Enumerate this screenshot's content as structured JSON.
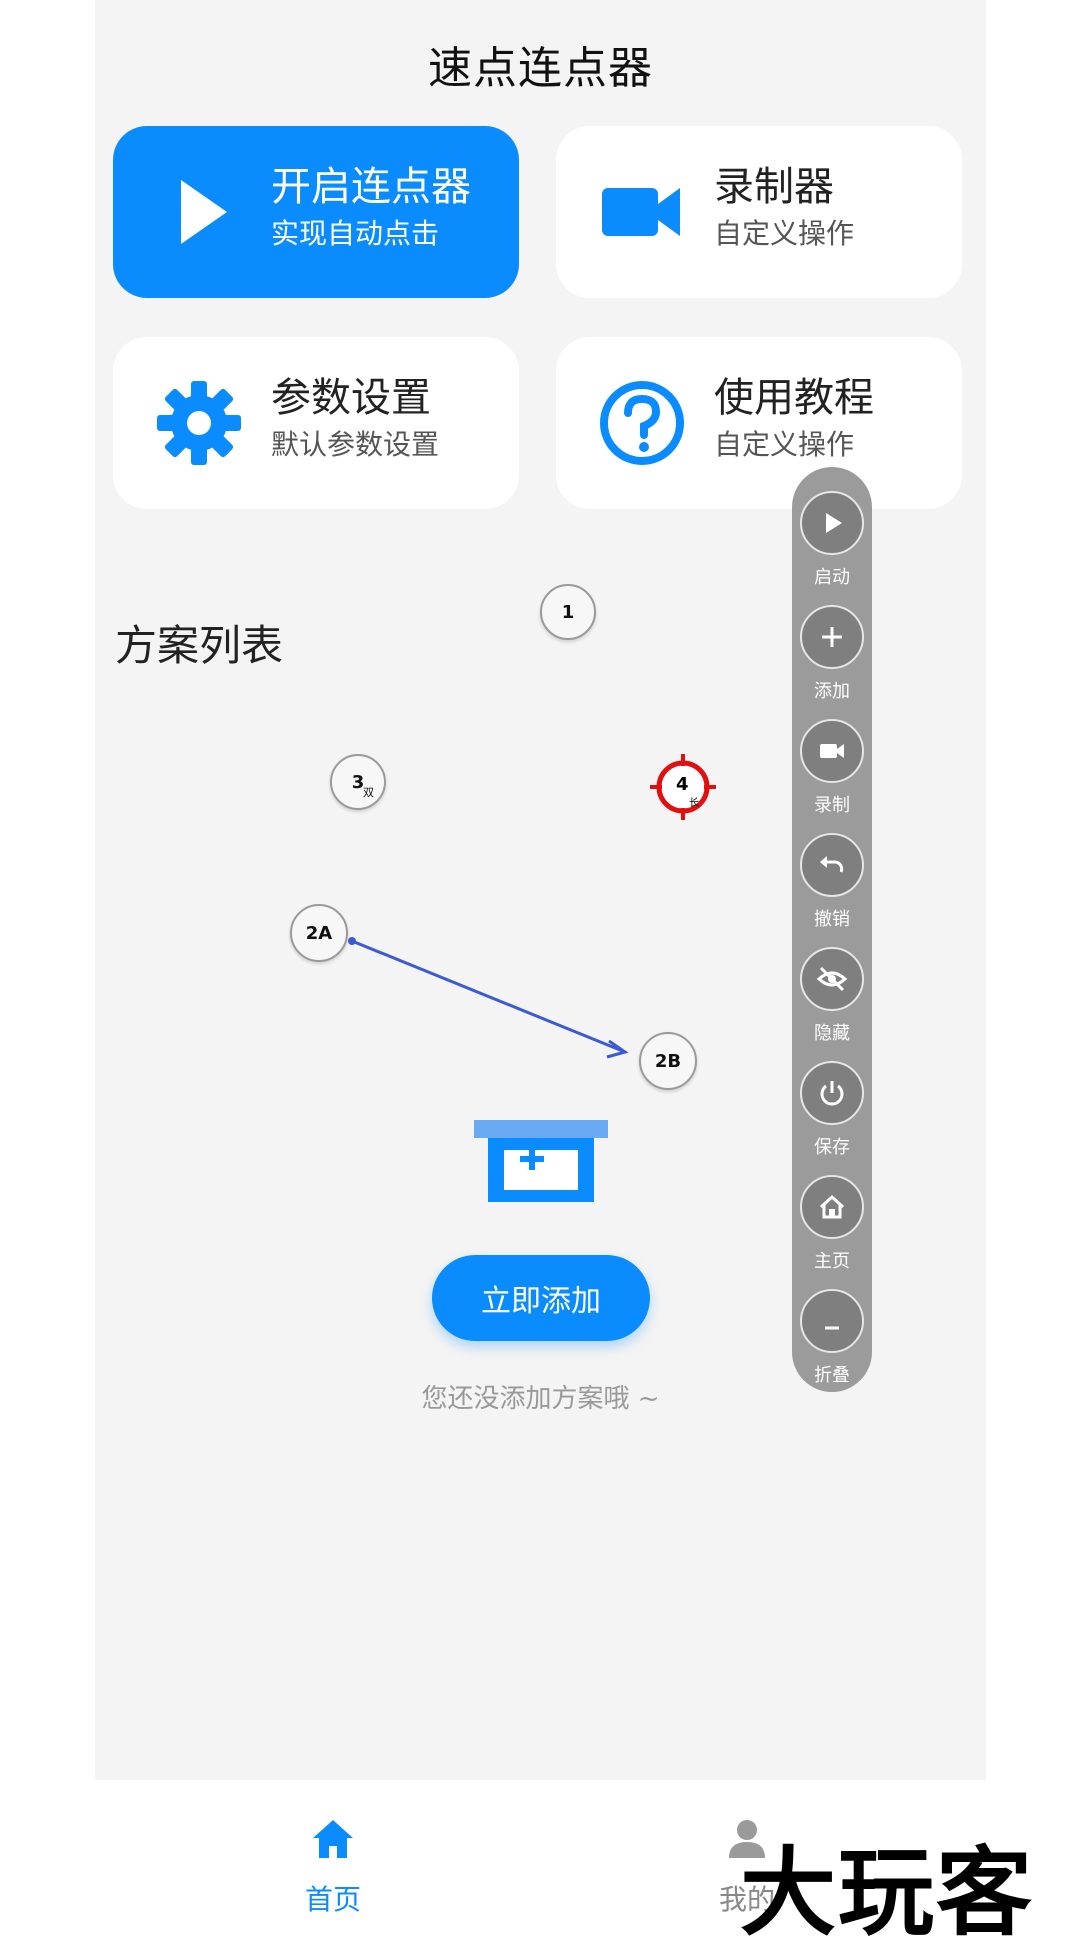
{
  "header": {
    "title": "速点连点器"
  },
  "cards": [
    {
      "title": "开启连点器",
      "subtitle": "实现自动点击",
      "icon": "play-icon"
    },
    {
      "title": "录制器",
      "subtitle": "自定义操作",
      "icon": "video-camera-icon"
    },
    {
      "title": "参数设置",
      "subtitle": "默认参数设置",
      "icon": "gear-icon"
    },
    {
      "title": "使用教程",
      "subtitle": "自定义操作",
      "icon": "question-circle-icon"
    }
  ],
  "section": {
    "title": "方案列表"
  },
  "markers": {
    "m1": "1",
    "m2a": "2A",
    "m2b": "2B",
    "m3": "3",
    "m3_sub": "双",
    "m4": "4",
    "m4_sub": "长"
  },
  "empty_state": {
    "button_label": "立即添加",
    "text": "您还没添加方案哦 ~"
  },
  "floating_panel": {
    "buttons": [
      {
        "label": "启动",
        "icon": "play-icon"
      },
      {
        "label": "添加",
        "icon": "plus-icon"
      },
      {
        "label": "录制",
        "icon": "video-camera-icon"
      },
      {
        "label": "撤销",
        "icon": "undo-icon"
      },
      {
        "label": "隐藏",
        "icon": "eye-off-icon"
      },
      {
        "label": "保存",
        "icon": "power-icon"
      },
      {
        "label": "主页",
        "icon": "home-icon"
      },
      {
        "label": "折叠",
        "icon": "minus-icon"
      }
    ]
  },
  "bottom_nav": {
    "items": [
      {
        "label": "首页",
        "icon": "home-icon",
        "active": true
      },
      {
        "label": "我的",
        "icon": "user-icon",
        "active": false
      }
    ]
  },
  "watermark": {
    "text": "大玩客"
  },
  "colors": {
    "accent": "#0a8cff",
    "panel": "#9b9b9b",
    "target_red": "#e01010",
    "swipe_line": "#3b5bd6"
  }
}
